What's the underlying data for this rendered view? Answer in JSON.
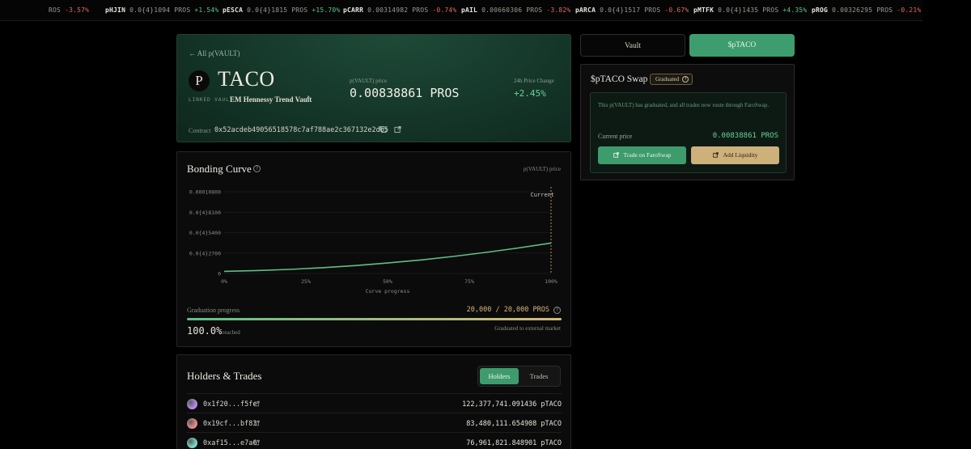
{
  "ticker": [
    {
      "symbol": "",
      "price": "ROS",
      "change": "-3.57%",
      "dir": "neg"
    },
    {
      "symbol": "pHJIN",
      "price": "0.0{4}1094 PROS",
      "change": "+1.54%",
      "dir": "pos"
    },
    {
      "symbol": "pESCA",
      "price": "0.0{4}1815 PROS",
      "change": "+15.70%",
      "dir": "pos"
    },
    {
      "symbol": "pCARR",
      "price": "0.00314982 PROS",
      "change": "-0.74%",
      "dir": "neg"
    },
    {
      "symbol": "pAIL",
      "price": "0.00660306 PROS",
      "change": "-3.82%",
      "dir": "neg"
    },
    {
      "symbol": "pARCA",
      "price": "0.0{4}1517 PROS",
      "change": "-0.67%",
      "dir": "neg"
    },
    {
      "symbol": "pMTFK",
      "price": "0.0{4}1435 PROS",
      "change": "+4.35%",
      "dir": "pos"
    },
    {
      "symbol": "pROG",
      "price": "0.00326295 PROS",
      "change": "-0.21%",
      "dir": "neg"
    }
  ],
  "hero": {
    "back_link": "← All p(VAULT)",
    "logo_letter": "P",
    "name": "TACO",
    "linked_label": "LINKED VAULT",
    "linked_value": "EM Hennessy Trend Vault",
    "price_label": "p(VAULT) price",
    "price_value": "0.00838861 PROS",
    "change_label": "24h Price Change",
    "change_value": "+2.45%",
    "contract_label": "Contract",
    "contract_value": "0x52acdeb49056518578c7af788ae2c367132e2db5"
  },
  "bonding": {
    "title": "Bonding Curve",
    "y_caption": "p(VAULT) price",
    "progress_label": "Graduation progress",
    "progress_value": "20,000 / 20,000 PROS",
    "progress_fraction": 1.0,
    "progress_pct": "100.0%",
    "progress_pct_sub": "reached",
    "progress_note": "Graduated to external market"
  },
  "chart_data": {
    "type": "line",
    "title": "",
    "xlabel": "Curve progress",
    "ylabel": "",
    "x_ticks": [
      "0%",
      "25%",
      "50%",
      "75%",
      "100%"
    ],
    "y_ticks": [
      "0",
      "0.0{4}2700",
      "0.0{4}5400",
      "0.0{4}8100",
      "0.00010800"
    ],
    "xlim": [
      0,
      100
    ],
    "ylim": [
      0,
      0.000108
    ],
    "marker_label": "Current",
    "marker_x": 100,
    "series": [
      {
        "x": [
          0,
          10,
          20,
          30,
          40,
          50,
          60,
          70,
          80,
          90,
          100
        ],
        "y": [
          2.8e-06,
          3.8e-06,
          5.4e-06,
          7.6e-06,
          1.04e-05,
          1.38e-05,
          1.78e-05,
          2.25e-05,
          2.78e-05,
          3.37e-05,
          4.02e-05
        ]
      }
    ]
  },
  "holders": {
    "title": "Holders & Trades",
    "tab_holders": "Holders",
    "tab_trades": "Trades",
    "rows": [
      {
        "address": "0x1f20...f5fe",
        "amount": "122,377,741.091436 pTACO",
        "avatar": "#b48ae8"
      },
      {
        "address": "0x19cf...bf83",
        "amount": "83,480,111.654908 pTACO",
        "avatar": "#e88a8a"
      },
      {
        "address": "0xaf15...e7a6",
        "amount": "76,961,821.848901 pTACO",
        "avatar": "#7ad6c2"
      }
    ]
  },
  "tabs": {
    "vault": "Vault",
    "ptaco": "$pTACO"
  },
  "swap": {
    "title": "$pTACO Swap",
    "badge": "Graduated",
    "message": "This p(VAULT) has graduated, and all trades now route through FaroSwap.",
    "current_label": "Current price",
    "current_value": "0.00838861 PROS",
    "trade_btn": "Trade on FaroSwap",
    "liquidity_btn": "Add Liquidity"
  }
}
